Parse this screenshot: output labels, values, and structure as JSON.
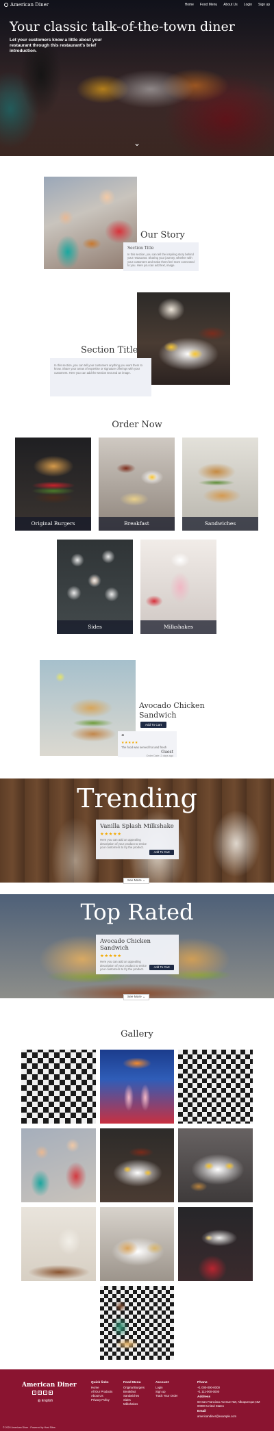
{
  "nav": {
    "brand": "American Diner",
    "links": [
      "Home",
      "Food Menu",
      "About Us",
      "Login",
      "Sign up"
    ]
  },
  "hero": {
    "title": "Your classic talk-of-the-town diner",
    "subtitle": "Let your customers know a little about your restaurant through this restaurant's brief introduction."
  },
  "story": {
    "title": "Our Story",
    "card1_title": "Section Title",
    "card1_body": "In this section, you can tell the inspiring story behind your restaurant. Sharing your journey, whether with your customers and make them feel more connected to you. Here you can add text, image.",
    "title2": "Section Title",
    "card2_body": "In this section, you can tell your customers anything you want them to know. Share your areas of expertise or signature offerings with your customers. Here you can add the section text and an image."
  },
  "order": {
    "title": "Order Now",
    "tiles": [
      "Original Burgers",
      "Breakfast",
      "Sandwiches",
      "Sides",
      "Milkshakes"
    ]
  },
  "featured": {
    "title": "Avocado Chicken Sandwich",
    "cart": "Add To Cart",
    "review": {
      "quote_icon": "quote-icon",
      "stars": "★★★★★",
      "text": "The food was served hot and fresh",
      "name": "Guest",
      "date": "Order Date: 2 days ago"
    }
  },
  "trending": {
    "title": "Trending",
    "product": "Vanilla Splash Milkshake",
    "stars": "★★★★★",
    "desc": "Here you can add an appealing description of your product to entice your customers to try the product.",
    "cart": "Add To Cart",
    "see_more": "See More"
  },
  "top_rated": {
    "title": "Top Rated",
    "product": "Avocado Chicken Sandwich",
    "stars": "★★★★★",
    "desc": "Here you can add an appealing description of your product to entice your customers to try the product.",
    "cart": "Add To Cart",
    "see_more": "See More"
  },
  "gallery": {
    "title": "Gallery"
  },
  "footer": {
    "brand": "American Diner",
    "social_icons": [
      "facebook-icon",
      "instagram-icon",
      "twitter-icon",
      "youtube-icon"
    ],
    "language": "English",
    "quick_links": {
      "title": "Quick links",
      "items": [
        "Home",
        "All Our Products",
        "About Us",
        "Privacy Policy"
      ]
    },
    "food_menu": {
      "title": "Food Menu",
      "items": [
        "Original Burgers",
        "Breakfast",
        "Sandwiches",
        "Sides",
        "Milkshakes"
      ]
    },
    "account": {
      "title": "Account",
      "items": [
        "Login",
        "Sign up",
        "Track Your Order"
      ]
    },
    "phone": {
      "title": "Phone",
      "items": [
        "+1 000-000-0000",
        "+1 111-000-0000"
      ]
    },
    "address": {
      "title": "Address",
      "items": [
        "00 San Francisco Avenue NW, Albuquerque,NM",
        "00000 United States"
      ]
    },
    "email": {
      "title": "Email",
      "items": [
        "americandiner@example.com"
      ]
    },
    "copyright": "© 2024 American Diner · Powered by Host Sites"
  },
  "colors": {
    "footer_bg": "#8a1430",
    "button": "#1e2a44",
    "stars": "#f2a900"
  }
}
